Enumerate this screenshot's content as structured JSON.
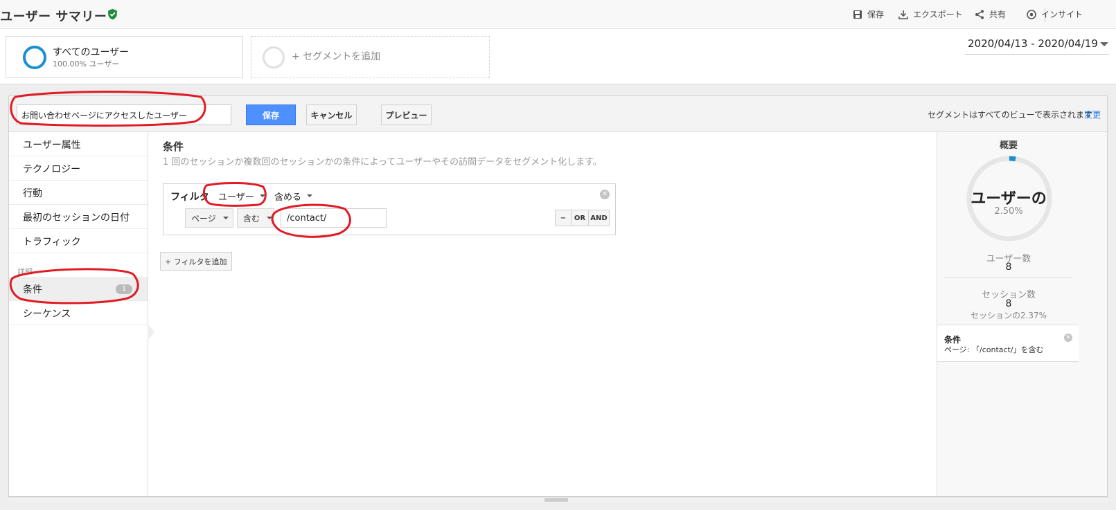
{
  "header": {
    "title": "ユーザー サマリー",
    "actions": [
      {
        "label": "保存",
        "icon": "save-icon"
      },
      {
        "label": "エクスポート",
        "icon": "download-icon"
      },
      {
        "label": "共有",
        "icon": "share-icon"
      },
      {
        "label": "インサイト",
        "icon": "insights-icon"
      }
    ]
  },
  "segments": {
    "active": {
      "name": "すべてのユーザー",
      "sub": "100.00% ユーザー"
    },
    "add_label": "+ セグメントを追加"
  },
  "date_range": "2020/04/13 - 2020/04/19",
  "editor": {
    "segment_name": "お問い合わせページにアクセスしたユーザー",
    "save_label": "保存",
    "cancel_label": "キャンセル",
    "preview_label": "プレビュー",
    "visibility_note": "セグメントはすべてのビューで表示されます",
    "change_label": "変更"
  },
  "nav": {
    "items": [
      "ユーザー属性",
      "テクノロジー",
      "行動",
      "最初のセッションの日付",
      "トラフィック"
    ],
    "advanced_header": "詳細",
    "conditions_label": "条件",
    "conditions_count": "1",
    "sequences_label": "シーケンス"
  },
  "content": {
    "title": "条件",
    "description": "1 回のセッションか複数回のセッションかの条件によってユーザーやその訪問データをセグメント化します。",
    "filter_label": "フィルタ",
    "filter_scope": "ユーザー",
    "filter_include": "含める",
    "dimension": "ページ",
    "operator": "含む",
    "value": "/contact/",
    "minus_label": "−",
    "or_label": "OR",
    "and_label": "AND",
    "add_filter_label": "+ フィルタを追加"
  },
  "summary": {
    "title": "概要",
    "headline": "ユーザーの",
    "percent": "2.50%",
    "percent_value": 0.025,
    "users_label": "ユーザー数",
    "users_value": "8",
    "sessions_label": "セッション数",
    "sessions_value": "8",
    "sessions_pct": "セッションの2.37%",
    "condition_title": "条件",
    "condition_text": "ページ: 「/contact/」を含む"
  },
  "colors": {
    "accent": "#4d90fe",
    "segment_ring": "#1a8fd1",
    "verified": "#1e8e3e",
    "annotation": "#e01b24"
  }
}
